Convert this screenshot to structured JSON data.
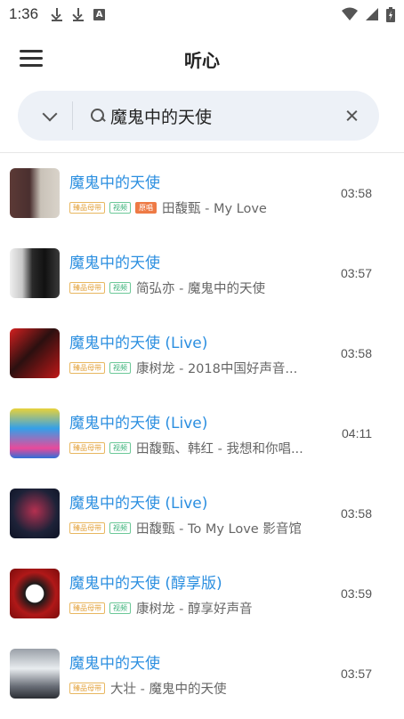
{
  "status_bar": {
    "time": "1:36",
    "notif_letter": "A"
  },
  "header": {
    "title": "听心"
  },
  "search": {
    "query": "魔鬼中的天使"
  },
  "songs": [
    {
      "title": "魔鬼中的天使",
      "tags": [
        "臻品母带",
        "视频",
        "原唱"
      ],
      "artist": "田馥甄 - My Love",
      "duration": "03:58"
    },
    {
      "title": "魔鬼中的天使",
      "tags": [
        "臻品母带",
        "视频"
      ],
      "artist": "简弘亦 - 魔鬼中的天使",
      "duration": "03:57"
    },
    {
      "title": "魔鬼中的天使 (Live)",
      "tags": [
        "臻品母带",
        "视频"
      ],
      "artist": "康树龙 - 2018中国好声音...",
      "duration": "03:58"
    },
    {
      "title": "魔鬼中的天使 (Live)",
      "tags": [
        "臻品母带",
        "视频"
      ],
      "artist": "田馥甄、韩红 - 我想和你唱...",
      "duration": "04:11"
    },
    {
      "title": "魔鬼中的天使 (Live)",
      "tags": [
        "臻品母带",
        "视频"
      ],
      "artist": "田馥甄 - To My Love 影音馆",
      "duration": "03:58"
    },
    {
      "title": "魔鬼中的天使 (醇享版)",
      "tags": [
        "臻品母带",
        "视频"
      ],
      "artist": "康树龙 - 醇享好声音",
      "duration": "03:59"
    },
    {
      "title": "魔鬼中的天使",
      "tags": [
        "臻品母带"
      ],
      "artist": "大壮 - 魔鬼中的天使",
      "duration": "03:57"
    }
  ]
}
